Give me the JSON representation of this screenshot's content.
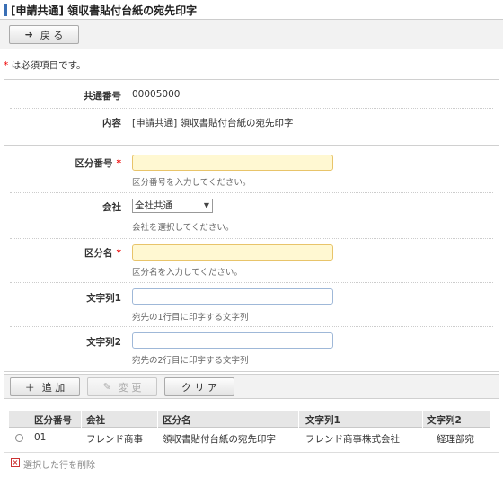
{
  "page": {
    "title": "[申請共通] 領収書貼付台紙の宛先印字"
  },
  "toolbar": {
    "back_label": "戻 る",
    "back_icon": "arrow-left-icon"
  },
  "required_note": {
    "star": "*",
    "text": "は必須項目です。"
  },
  "summary": {
    "common_no_label": "共通番号",
    "common_no_value": "00005000",
    "content_label": "内容",
    "content_value": "[申請共通] 領収書貼付台紙の宛先印字"
  },
  "form": {
    "required_star": "*",
    "category_no": {
      "label": "区分番号",
      "value": "",
      "hint": "区分番号を入力してください。"
    },
    "company": {
      "label": "会社",
      "selected": "全社共通",
      "hint": "会社を選択してください。"
    },
    "category_name": {
      "label": "区分名",
      "value": "",
      "hint": "区分名を入力してください。"
    },
    "string1": {
      "label": "文字列1",
      "value": "",
      "hint": "宛先の1行目に印字する文字列"
    },
    "string2": {
      "label": "文字列2",
      "value": "",
      "hint": "宛先の2行目に印字する文字列"
    }
  },
  "actions": {
    "add_label": "追 加",
    "add_icon": "plus-icon",
    "change_label": "変 更",
    "change_icon": "pencil-icon",
    "clear_label": "ク リ ア"
  },
  "table": {
    "columns": [
      "区分番号",
      "会社",
      "区分名",
      "文字列1",
      "文字列2"
    ],
    "rows": [
      [
        "01",
        "フレンド商事",
        "領収書貼付台紙の宛先印字",
        "フレンド商事株式会社",
        "経理部宛"
      ]
    ]
  },
  "footer": {
    "delete_label": "選択した行を削除"
  },
  "colors": {
    "accent": "#3a6fb5",
    "required_bg": "#fff8d2",
    "required_star": "#e00000"
  }
}
